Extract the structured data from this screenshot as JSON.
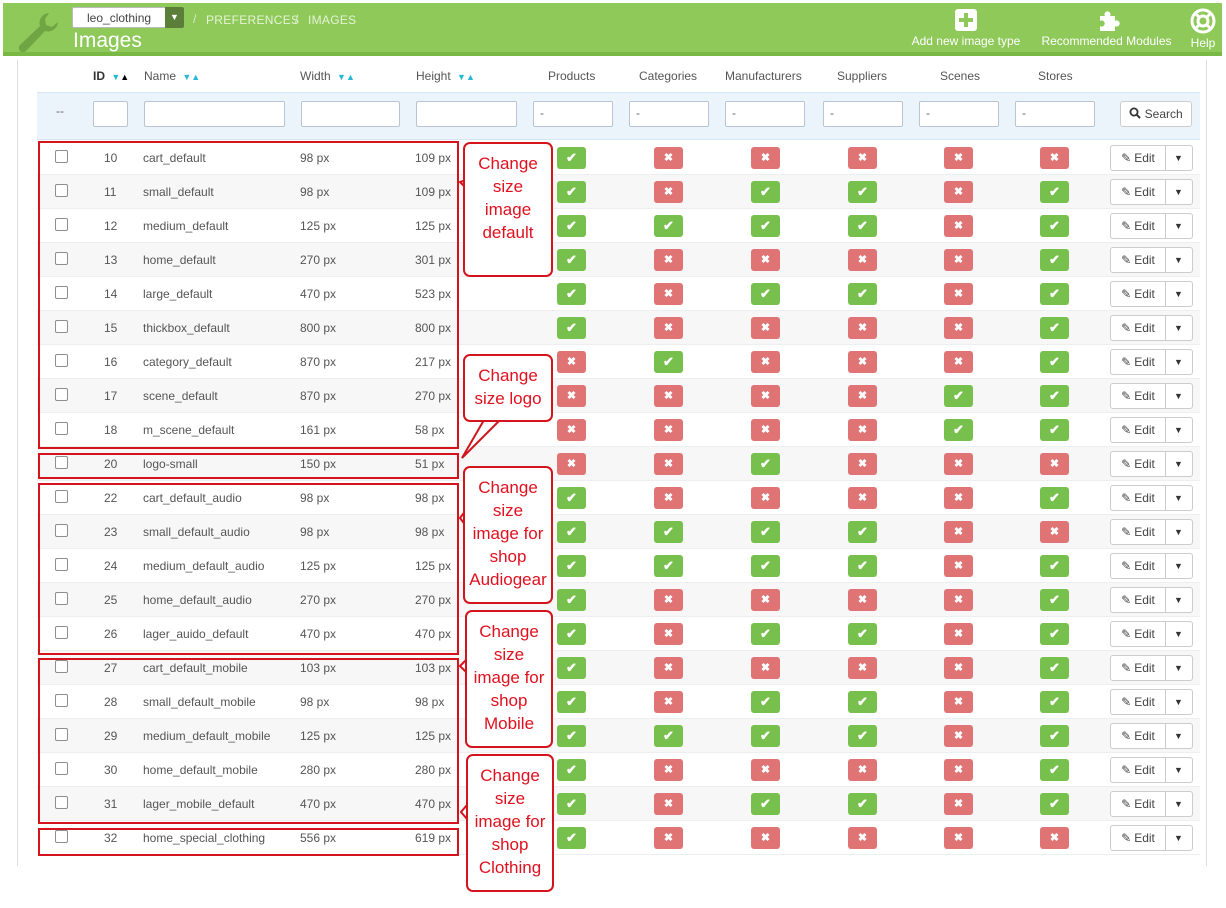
{
  "header": {
    "shop_select": "leo_clothing",
    "breadcrumb": [
      "PREFERENCES",
      "IMAGES"
    ],
    "breadcrumb_sep": "/",
    "title": "Images",
    "buttons": [
      {
        "label": "Add new image type",
        "icon": "plus-square-icon"
      },
      {
        "label": "Recommended Modules",
        "icon": "puzzle-icon"
      },
      {
        "label": "Help",
        "icon": "lifebuoy-icon"
      }
    ]
  },
  "table": {
    "columns": {
      "id": "ID",
      "name": "Name",
      "width": "Width",
      "height": "Height",
      "products": "Products",
      "categories": "Categories",
      "manufacturers": "Manufacturers",
      "suppliers": "Suppliers",
      "scenes": "Scenes",
      "stores": "Stores"
    },
    "filters": {
      "bulk": "--",
      "select_placeholder": "-",
      "search_label": "Search"
    },
    "edit_label": "Edit",
    "rows": [
      {
        "id": "10",
        "name": "cart_default",
        "width": "98 px",
        "height": "109 px",
        "flags": [
          1,
          0,
          0,
          0,
          0,
          0
        ]
      },
      {
        "id": "11",
        "name": "small_default",
        "width": "98 px",
        "height": "109 px",
        "flags": [
          1,
          0,
          1,
          1,
          0,
          1
        ]
      },
      {
        "id": "12",
        "name": "medium_default",
        "width": "125 px",
        "height": "125 px",
        "flags": [
          1,
          1,
          1,
          1,
          0,
          1
        ]
      },
      {
        "id": "13",
        "name": "home_default",
        "width": "270 px",
        "height": "301 px",
        "flags": [
          1,
          0,
          0,
          0,
          0,
          1
        ]
      },
      {
        "id": "14",
        "name": "large_default",
        "width": "470 px",
        "height": "523 px",
        "flags": [
          1,
          0,
          1,
          1,
          0,
          1
        ]
      },
      {
        "id": "15",
        "name": "thickbox_default",
        "width": "800 px",
        "height": "800 px",
        "flags": [
          1,
          0,
          0,
          0,
          0,
          1
        ]
      },
      {
        "id": "16",
        "name": "category_default",
        "width": "870 px",
        "height": "217 px",
        "flags": [
          0,
          1,
          0,
          0,
          0,
          1
        ]
      },
      {
        "id": "17",
        "name": "scene_default",
        "width": "870 px",
        "height": "270 px",
        "flags": [
          0,
          0,
          0,
          0,
          1,
          1
        ]
      },
      {
        "id": "18",
        "name": "m_scene_default",
        "width": "161 px",
        "height": "58 px",
        "flags": [
          0,
          0,
          0,
          0,
          1,
          1
        ]
      },
      {
        "id": "20",
        "name": "logo-small",
        "width": "150 px",
        "height": "51 px",
        "flags": [
          0,
          0,
          1,
          0,
          0,
          0
        ]
      },
      {
        "id": "22",
        "name": "cart_default_audio",
        "width": "98 px",
        "height": "98 px",
        "flags": [
          1,
          0,
          0,
          0,
          0,
          1
        ]
      },
      {
        "id": "23",
        "name": "small_default_audio",
        "width": "98 px",
        "height": "98 px",
        "flags": [
          1,
          1,
          1,
          1,
          0,
          0
        ]
      },
      {
        "id": "24",
        "name": "medium_default_audio",
        "width": "125 px",
        "height": "125 px",
        "flags": [
          1,
          1,
          1,
          1,
          0,
          1
        ]
      },
      {
        "id": "25",
        "name": "home_default_audio",
        "width": "270 px",
        "height": "270 px",
        "flags": [
          1,
          0,
          0,
          0,
          0,
          1
        ]
      },
      {
        "id": "26",
        "name": "lager_auido_default",
        "width": "470 px",
        "height": "470 px",
        "flags": [
          1,
          0,
          1,
          1,
          0,
          1
        ]
      },
      {
        "id": "27",
        "name": "cart_default_mobile",
        "width": "103 px",
        "height": "103 px",
        "flags": [
          1,
          0,
          0,
          0,
          0,
          1
        ]
      },
      {
        "id": "28",
        "name": "small_default_mobile",
        "width": "98 px",
        "height": "98 px",
        "flags": [
          1,
          0,
          1,
          1,
          0,
          1
        ]
      },
      {
        "id": "29",
        "name": "medium_default_mobile",
        "width": "125 px",
        "height": "125 px",
        "flags": [
          1,
          1,
          1,
          1,
          0,
          1
        ]
      },
      {
        "id": "30",
        "name": "home_default_mobile",
        "width": "280 px",
        "height": "280 px",
        "flags": [
          1,
          0,
          0,
          0,
          0,
          1
        ]
      },
      {
        "id": "31",
        "name": "lager_mobile_default",
        "width": "470 px",
        "height": "470 px",
        "flags": [
          1,
          0,
          1,
          1,
          0,
          1
        ]
      },
      {
        "id": "32",
        "name": "home_special_clothing",
        "width": "556 px",
        "height": "619 px",
        "flags": [
          1,
          0,
          0,
          0,
          0,
          0
        ]
      }
    ]
  },
  "annotations": [
    {
      "text": "Change size image default",
      "lines": [
        "Change",
        "size",
        "image",
        "default"
      ]
    },
    {
      "text": "Change size logo",
      "lines": [
        "Change",
        "size logo"
      ]
    },
    {
      "text": "Change size image for shop Audiogear",
      "lines": [
        "Change",
        "size",
        "image for",
        "shop",
        "Audiogear"
      ]
    },
    {
      "text": "Change size image for shop Mobile",
      "lines": [
        "Change",
        "size",
        "image for",
        "shop",
        "Mobile"
      ]
    },
    {
      "text": "Change size image for shop Clothing",
      "lines": [
        "Change",
        "size",
        "image for",
        "shop",
        "Clothing"
      ]
    }
  ],
  "colors": {
    "header_green": "#8ec95a",
    "yes_badge": "#78c04d",
    "no_badge": "#e07474",
    "annotation_red": "#d4141c",
    "sort_arrow": "#25b9d7"
  }
}
